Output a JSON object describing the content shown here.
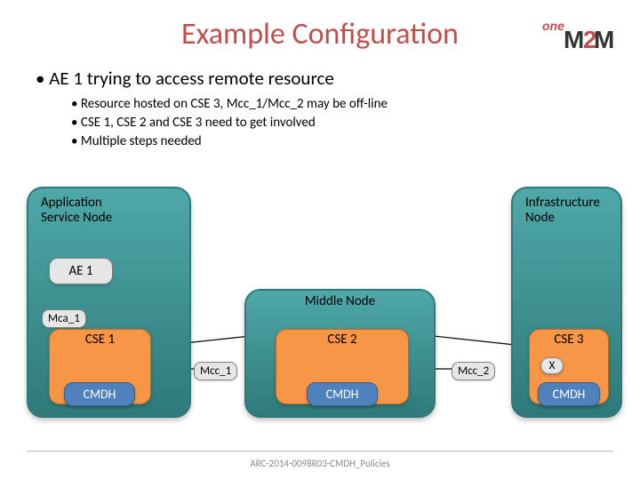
{
  "title": "Example Configuration",
  "logo": {
    "brand_one": "one",
    "brand_m": "M",
    "brand_2": "2",
    "brand_m2": "M"
  },
  "bullets": {
    "top": "AE 1 trying to access remote resource",
    "subs": [
      "Resource hosted on CSE 3, Mcc_1/Mcc_2 may be off-line",
      "CSE 1, CSE 2 and CSE 3 need to get involved",
      "Multiple steps needed"
    ]
  },
  "nodes": {
    "asn": {
      "label_l1": "Application",
      "label_l2": "Service Node"
    },
    "mn": {
      "label": "Middle Node"
    },
    "in": {
      "label_l1": "Infrastructure",
      "label_l2": "Node"
    }
  },
  "boxes": {
    "ae1": "AE 1",
    "cse1": "CSE 1",
    "cse2": "CSE 2",
    "cse3": "CSE 3",
    "cmdh": "CMDH"
  },
  "connectors": {
    "mca1": "Mca_1",
    "mcc1": "Mcc_1",
    "mcc2": "Mcc_2"
  },
  "x_marker": "X",
  "footer": "ARC-2014-0098R03-CMDH_Policies"
}
